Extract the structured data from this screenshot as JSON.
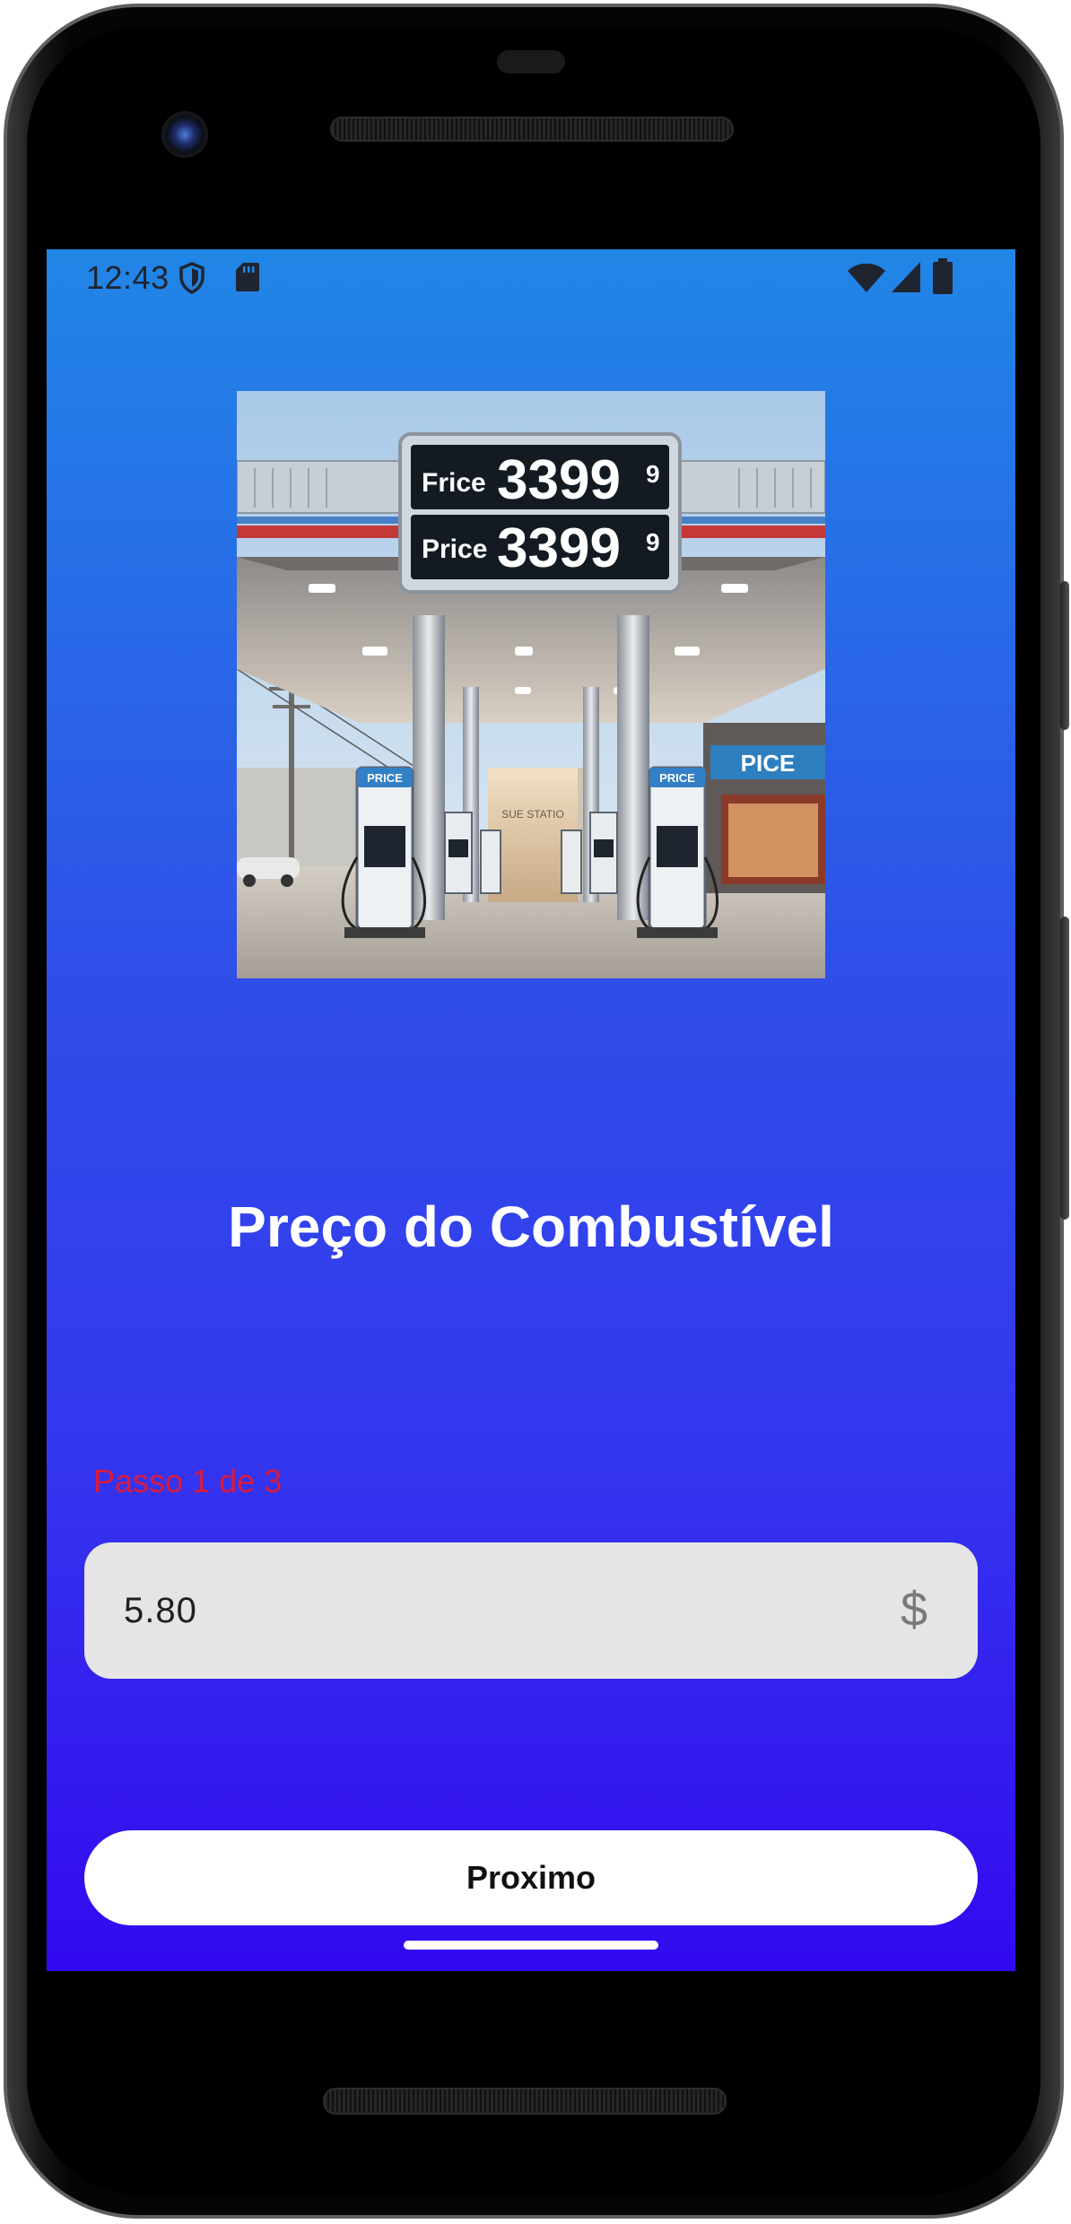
{
  "status_bar": {
    "time": "12:43",
    "left_icons": [
      "shield-icon",
      "sd-card-icon"
    ],
    "right_icons": [
      "wifi-icon",
      "cell-signal-icon",
      "battery-icon"
    ]
  },
  "hero": {
    "sign_rows": [
      {
        "label": "Frice",
        "price": "3399",
        "suffix": "9"
      },
      {
        "label": "Price",
        "price": "3399",
        "suffix": "9"
      }
    ],
    "pump_labels": [
      "PRICE",
      "PRICE"
    ],
    "store_sign": "PICE",
    "station_sign": "SUE STATIO"
  },
  "page": {
    "title": "Preço do Combustível",
    "step_text": "Passo 1 de 3",
    "price_input": {
      "value": "5.80",
      "currency": "$"
    },
    "next_button_label": "Proximo"
  },
  "colors": {
    "background_top": "#2186e6",
    "background_bottom": "#3309ef",
    "step_text": "#d81b3f",
    "input_background": "#e5e5e5",
    "button_background": "#ffffff"
  }
}
